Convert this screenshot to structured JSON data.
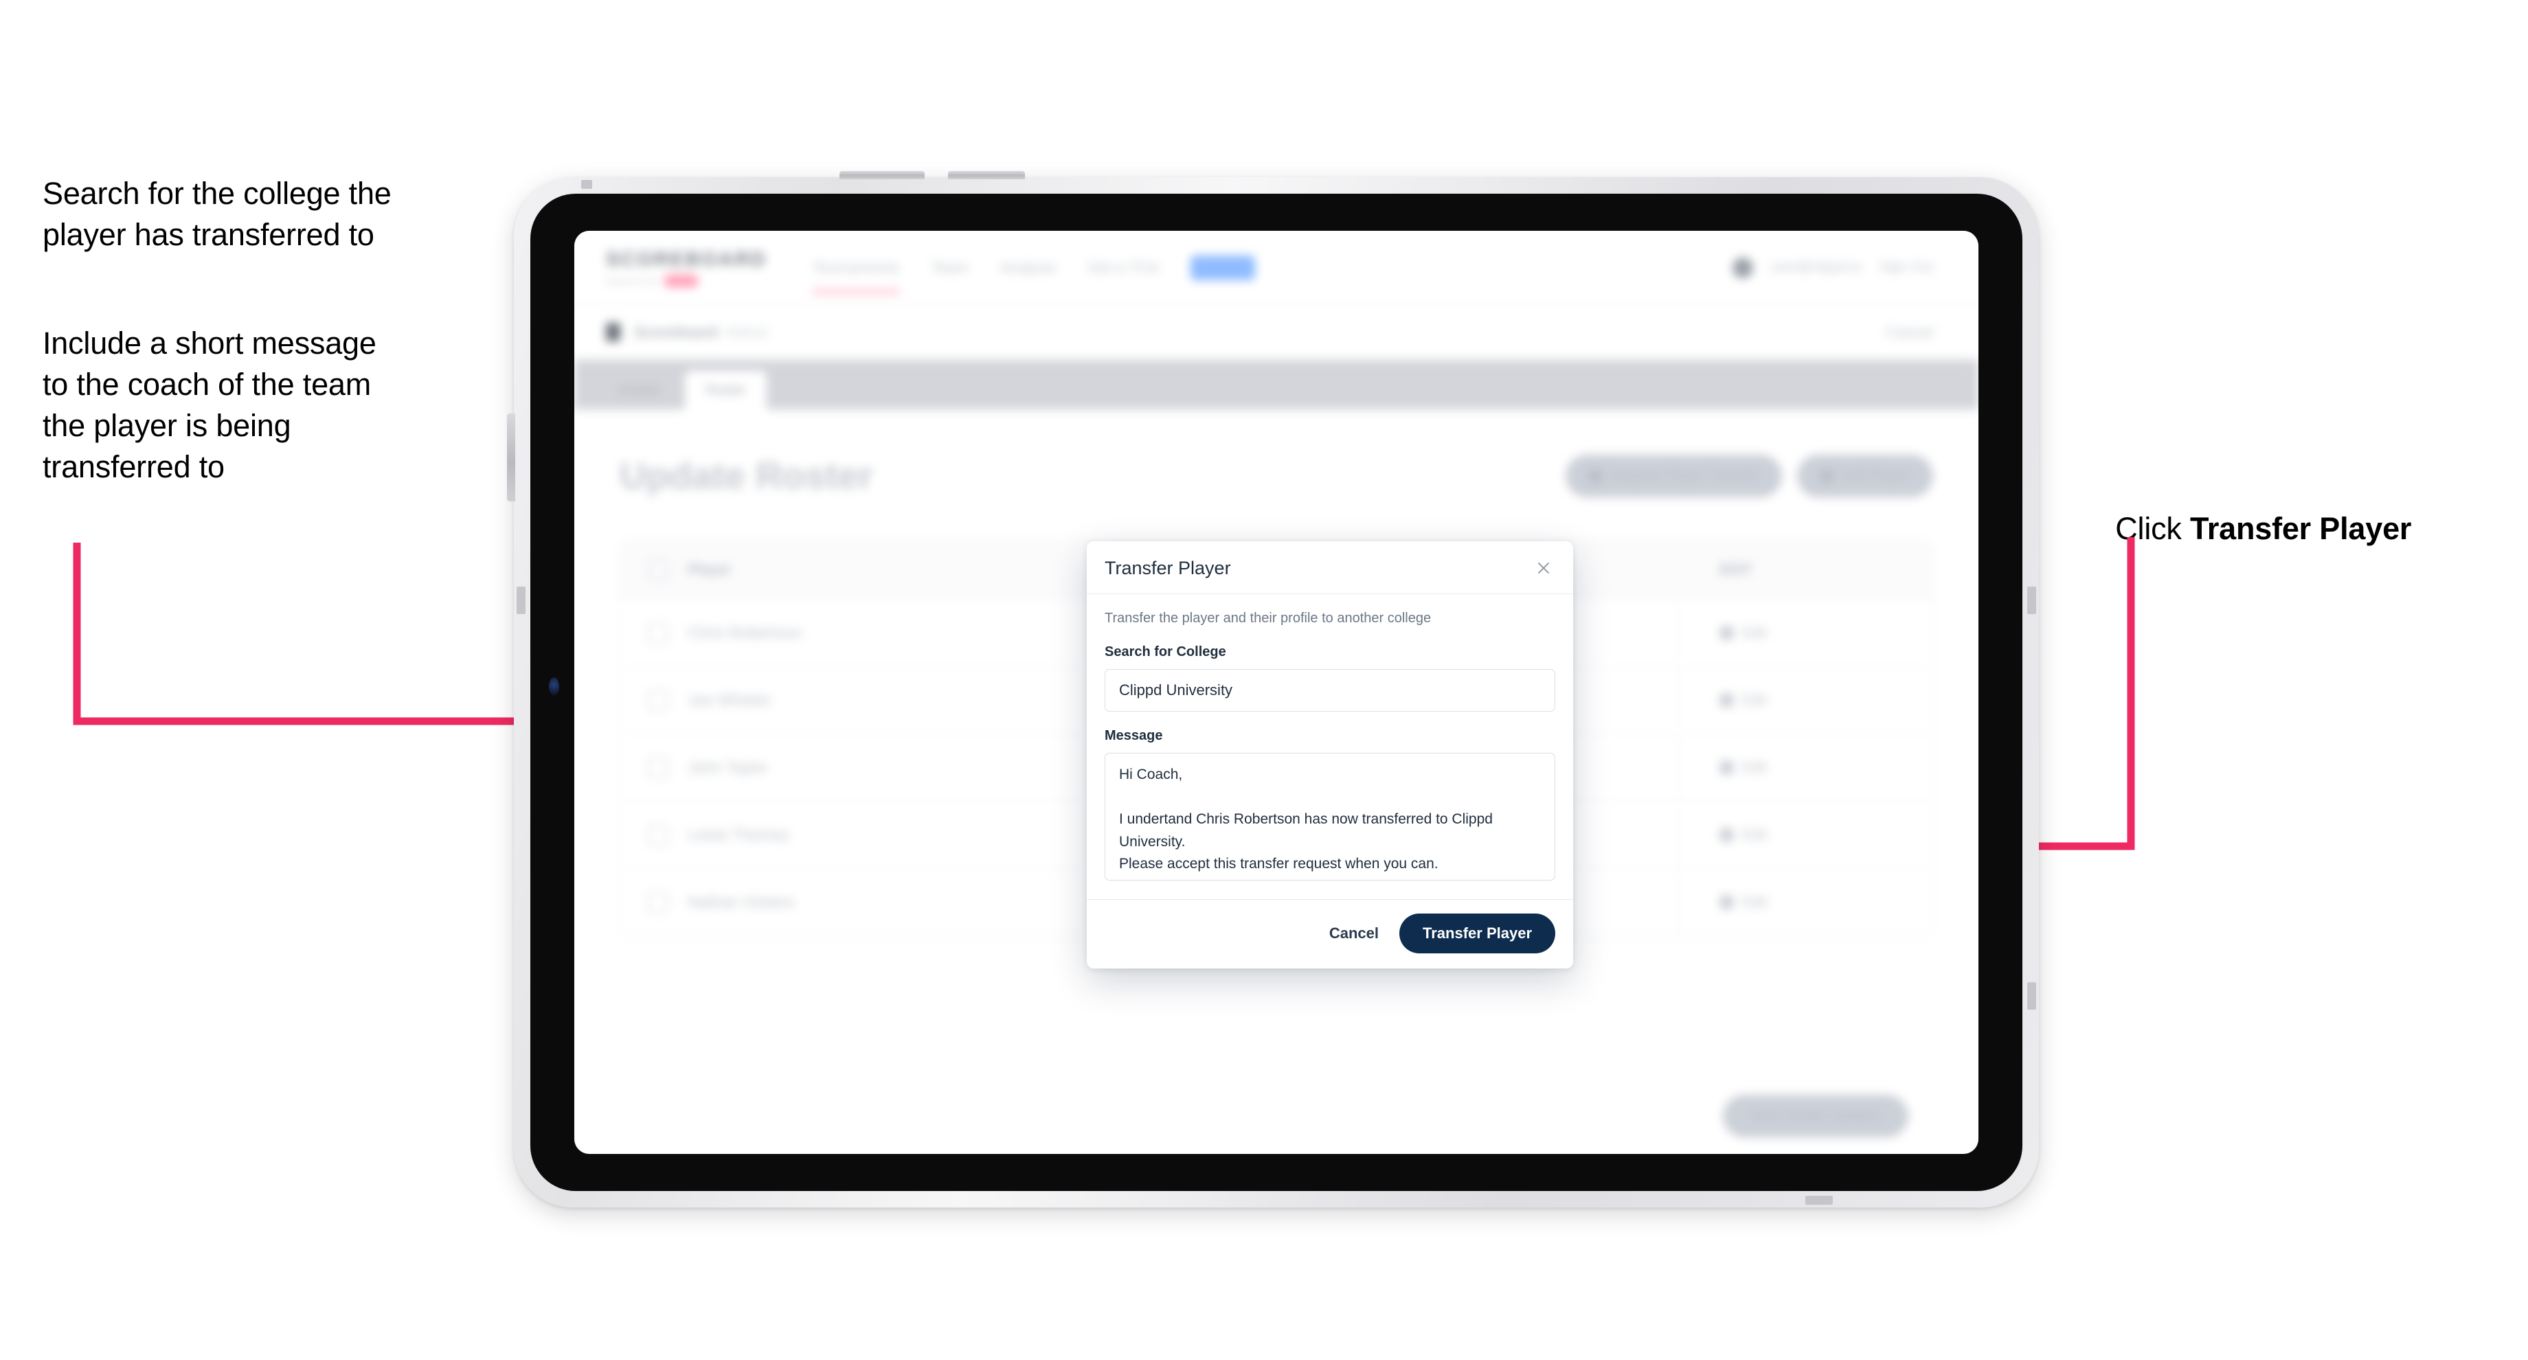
{
  "annotations": {
    "left_1": "Search for the college the\nplayer has transferred to",
    "left_2": "Include a short message\nto the coach of the team\nthe player is being\ntransferred to",
    "right_prefix": "Click ",
    "right_strong": "Transfer Player",
    "arrow_color": "#ee2a62"
  },
  "app": {
    "brand": {
      "name": "SCOREBOARD",
      "subtitle": "powered by",
      "badge": "clippd"
    },
    "nav": [
      {
        "label": "Tournaments"
      },
      {
        "label": "Team"
      },
      {
        "label": "Analysis"
      },
      {
        "label": "Get a TCA"
      },
      {
        "label": "Admin"
      }
    ],
    "topbar_right": {
      "account": "user@clippd.io",
      "signout": "Sign Out"
    },
    "breadcrumb": {
      "icon": "shield-icon",
      "title": "Scoreboard",
      "subtitle": "Admin",
      "right_action": "Cancel"
    },
    "tabs": [
      {
        "label": "Details",
        "active": false
      },
      {
        "label": "Roster",
        "active": true
      }
    ],
    "page": {
      "title": "Update Roster",
      "actions": [
        {
          "icon": "download-icon",
          "label": "Request Player Transfer"
        },
        {
          "icon": "plus-icon",
          "label": "Add Player"
        }
      ],
      "table": {
        "header_left": "Player",
        "header_right": "EDIT"
      },
      "rows": [
        {
          "name": "Chris Robertson",
          "edit": "Edit"
        },
        {
          "name": "Joe Whelan",
          "edit": "Edit"
        },
        {
          "name": "John Taylor",
          "edit": "Edit"
        },
        {
          "name": "Lewis Thomas",
          "edit": "Edit"
        },
        {
          "name": "Nathan Vickers",
          "edit": "Edit"
        }
      ],
      "footer_action": "Save Roster Updates"
    }
  },
  "modal": {
    "title": "Transfer Player",
    "close_icon": "close-icon",
    "description": "Transfer the player and their profile to another college",
    "college_label": "Search for College",
    "college_value": "Clippd University",
    "college_placeholder": "Search for College",
    "message_label": "Message",
    "message_value": "Hi Coach,\n\nI undertand Chris Robertson has now transferred to Clippd University.\nPlease accept this transfer request when you can.",
    "message_placeholder": "Message",
    "cancel_label": "Cancel",
    "submit_label": "Transfer Player",
    "submit_color": "#0d2c4e"
  }
}
